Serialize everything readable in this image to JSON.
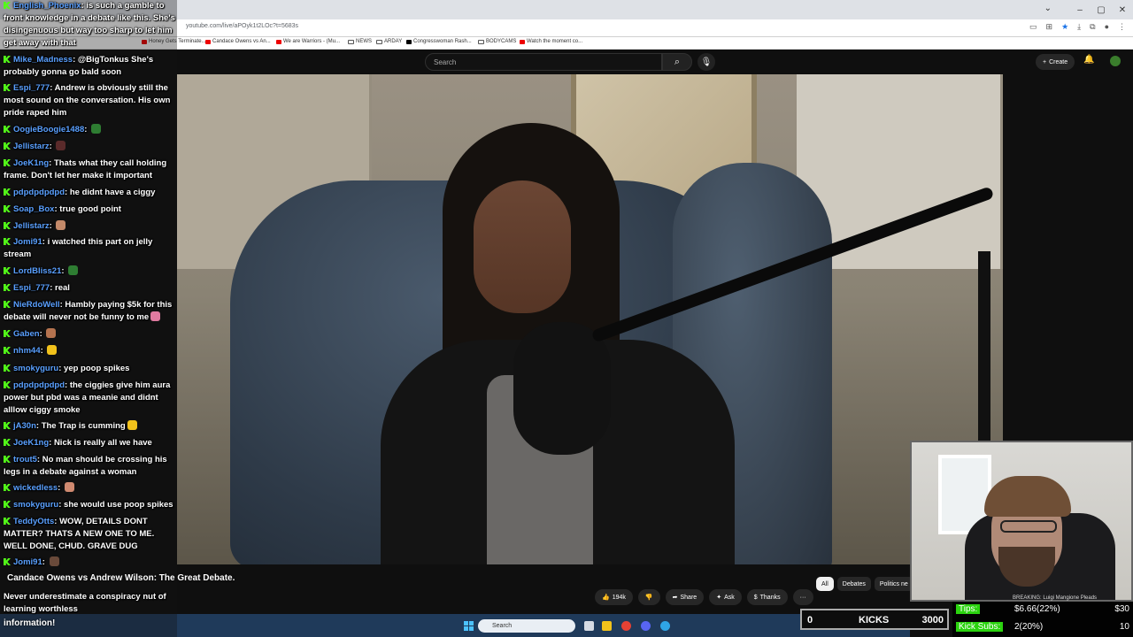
{
  "browser": {
    "url": "youtube.com/live/aPOyk1t2LOc?t=5683s",
    "bookmarks": [
      "Honey Gets Terminate...",
      "Candace Owens vs An...",
      "We are Warriors - (Mu...",
      "NEWS",
      "ARDAY",
      "Congresswoman Rash...",
      "BODYCAMS",
      "Watch the moment co..."
    ]
  },
  "youtube": {
    "search_placeholder": "Search",
    "create_label": "Create",
    "video_title": "Candace Owens vs Andrew Wilson: The Great Debate.",
    "likes": "194k",
    "share_label": "Share",
    "ask_label": "Ask",
    "thanks_label": "Thanks",
    "more_label": "···",
    "chips": [
      "All",
      "Debates",
      "Politics ne"
    ]
  },
  "chat": {
    "messages": [
      {
        "user": "English_Phoenix",
        "text": "is such a gamble to front knowledge in a debate like this. She's disingenuous but way too sharp to let him get away with that",
        "emote": ""
      },
      {
        "user": "Mike_Madness",
        "text": "@BigTonkus She's probably gonna go bald soon",
        "emote": ""
      },
      {
        "user": "Espi_777",
        "text": "Andrew is obviously still the most sound on the conversation. His own pride raped him",
        "emote": ""
      },
      {
        "user": "OogieBoogie1488",
        "text": "",
        "emote": "#2e7d32"
      },
      {
        "user": "Jellistarz",
        "text": "",
        "emote": "#5a2a2a"
      },
      {
        "user": "JoeK1ng",
        "text": "Thats what they call holding frame. Don't let her make it important",
        "emote": ""
      },
      {
        "user": "pdpdpdpdpd",
        "text": "he didnt have a ciggy",
        "emote": ""
      },
      {
        "user": "Soap_Box",
        "text": "true good point",
        "emote": ""
      },
      {
        "user": "Jellistarz",
        "text": "",
        "emote": "#c48a6a"
      },
      {
        "user": "Jomi91",
        "text": "i watched this part on jelly stream",
        "emote": ""
      },
      {
        "user": "LordBliss21",
        "text": "",
        "emote": "#2e7d32"
      },
      {
        "user": "Espi_777",
        "text": "real",
        "emote": ""
      },
      {
        "user": "NieRdoWell",
        "text": "Hambly paying $5k for this debate will never not be funny to me",
        "emote": "#e07aa0"
      },
      {
        "user": "Gaben",
        "text": "",
        "emote": "#b5734f"
      },
      {
        "user": "nhm44",
        "text": "",
        "emote": "#f2c21b"
      },
      {
        "user": "smokyguru",
        "text": "yep poop spikes",
        "emote": ""
      },
      {
        "user": "pdpdpdpdpd",
        "text": "the ciggies give him aura power but pbd was a meanie and didnt alllow ciggy smoke",
        "emote": ""
      },
      {
        "user": "jA30n",
        "text": "The Trap is cumming",
        "emote": "#f2c21b"
      },
      {
        "user": "JoeK1ng",
        "text": "Nick is really all we have",
        "emote": ""
      },
      {
        "user": "trout5",
        "text": "No man should be crossing his legs in a debate against a woman",
        "emote": ""
      },
      {
        "user": "wickedless",
        "text": "",
        "emote": "#d08a70"
      },
      {
        "user": "smokyguru",
        "text": "she would use poop spikes",
        "emote": ""
      },
      {
        "user": "TeddyOtts",
        "text": "WOW, DETAILS DONT MATTER? THATS A NEW ONE TO ME. WELL DONE, CHUD. GRAVE DUG",
        "emote": ""
      },
      {
        "user": "Jomi91",
        "text": "",
        "emote": "#6a4a3a"
      }
    ],
    "bottom_line_1": "Never underestimate a conspiracy nut of learning worthless",
    "bottom_line_2": "information!"
  },
  "overlay": {
    "breaking": "BREAKING: Luigi Mangione Pleads",
    "kicks_left": "0",
    "kicks_label": "KICKS",
    "kicks_right": "3000",
    "tips_label": "Tips:",
    "tips_value": "$6.66(22%)",
    "tips_goal": "$30",
    "subs_label": "Kick Subs:",
    "subs_value": "2(20%)",
    "subs_goal": "10"
  },
  "taskbar": {
    "search_label": "Search"
  }
}
